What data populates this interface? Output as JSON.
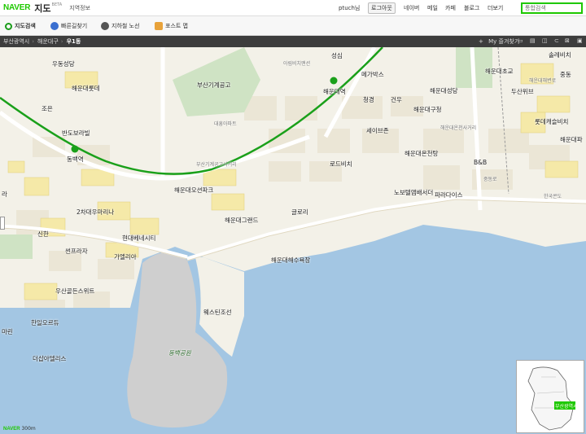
{
  "header": {
    "logo": "NAVER",
    "product": "지도",
    "beta": "BETA",
    "region_info": "지역정보",
    "user": "ptuch님",
    "logout": "로그아웃",
    "nav": [
      "네이버",
      "메일",
      "카페",
      "블로그",
      "더보기"
    ],
    "search_placeholder": "통합검색"
  },
  "toolbar": {
    "map_search": "지도검색",
    "directions": "빠른길찾기",
    "subway": "지하철 노선",
    "post": "포스트 맵"
  },
  "breadcrumb": {
    "city": "부산광역시",
    "district": "해운대구",
    "dong": "우1동",
    "favorites": "My 즐겨찾기"
  },
  "scale": {
    "logo": "NAVER",
    "distance": "300m"
  },
  "colors": {
    "accent": "#1ec800",
    "sea": "#a3c6e3",
    "land": "#f3f1e8"
  },
  "map": {
    "labels": [
      "우동성당",
      "해운대롯데",
      "조은",
      "반도보라빌",
      "동백역",
      "신한",
      "썬프라자",
      "우산골든스위트",
      "한일오르듀",
      "더샵아델리스",
      "마린",
      "라",
      "부산기계공고",
      "대흥아파트",
      "아림비치맨션",
      "성심",
      "메가박스",
      "해운대역",
      "청경",
      "건우",
      "해운대성당",
      "해운대구청",
      "세이브존",
      "해운대온천사거리",
      "해운대온천탕",
      "로드비치",
      "해운대오션파크",
      "해운대그랜드",
      "글로리",
      "부산기계공고사거리",
      "2차대우마리나",
      "현대베네시티",
      "가엘리아",
      "해운대해수욕장",
      "웨스틴조선",
      "동백공원",
      "노보텔앰배서더",
      "파라다이스",
      "B&B",
      "중동로",
      "한국콘도",
      "해운대초교",
      "두산위브",
      "롯데캐슬비치",
      "해운대파",
      "솔레비치",
      "중동",
      "해운대해변로",
      "부산광역시"
    ]
  }
}
